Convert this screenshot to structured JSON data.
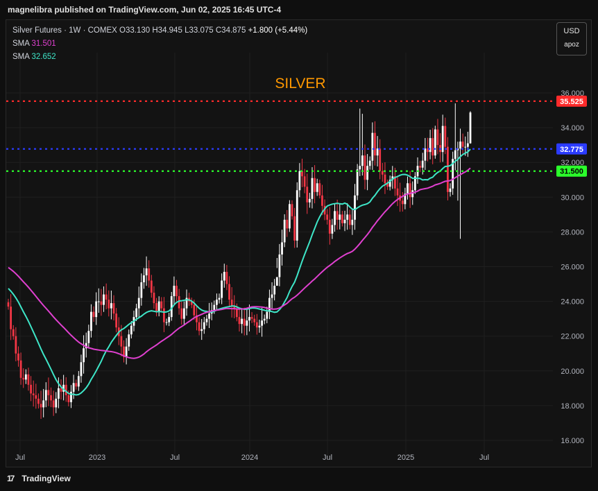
{
  "header": {
    "published_text": "magnelibra published on TradingView.com, Jun 02, 2025 16:45 UTC-4"
  },
  "legend": {
    "symbol": "Silver Futures · 1W · COMEX",
    "open_label": "O",
    "open": "33.130",
    "high_label": "H",
    "high": "34.945",
    "low_label": "L",
    "low": "33.075",
    "close_label": "C",
    "close": "34.875",
    "change": "+1.800 (+5.44%)",
    "sma1_label": "SMA",
    "sma1_value": "31.501",
    "sma2_label": "SMA",
    "sma2_value": "32.652"
  },
  "currency": {
    "code": "USD",
    "sub": "apoz"
  },
  "footer": {
    "brand": "TradingView"
  },
  "colors": {
    "up": "#ffffff",
    "down": "#f23645",
    "sma_long": "#e040d0",
    "sma_short": "#3ee6c8",
    "resistance": "#ff2b2b",
    "mid": "#2b3bff",
    "support": "#2bff2b",
    "title": "#ff9800"
  },
  "chart_data": {
    "type": "candlestick",
    "title": "SILVER",
    "ylim": [
      15.3,
      37.2
    ],
    "y_ticks": [
      "16.000",
      "18.000",
      "20.000",
      "22.000",
      "24.000",
      "26.000",
      "28.000",
      "30.000",
      "32.000",
      "34.000",
      "36.000"
    ],
    "x_ticks": [
      "Jul",
      "2023",
      "Jul",
      "2024",
      "Jul",
      "2025",
      "Jul"
    ],
    "horizontal_lines": [
      {
        "value": 35.525,
        "label": "35.525",
        "color": "#ff2b2b"
      },
      {
        "value": 32.775,
        "label": "32.775",
        "color": "#2b3bff"
      },
      {
        "value": 31.5,
        "label": "31.500",
        "color": "#2bff2b"
      }
    ],
    "series": [
      {
        "name": "SMA",
        "value": "31.501"
      },
      {
        "name": "SMA",
        "value": "32.652"
      }
    ],
    "closes": [
      23.7,
      22.4,
      22.0,
      21.0,
      20.6,
      19.6,
      19.5,
      19.8,
      19.2,
      18.7,
      18.6,
      18.4,
      18.1,
      17.9,
      18.3,
      18.9,
      18.6,
      18.3,
      17.9,
      18.4,
      19.0,
      18.8,
      19.2,
      18.6,
      18.2,
      18.8,
      19.3,
      19.1,
      19.7,
      20.5,
      21.3,
      21.6,
      22.3,
      23.4,
      23.1,
      24.0,
      24.0,
      23.8,
      24.4,
      24.1,
      23.6,
      23.9,
      23.3,
      22.5,
      22.0,
      21.4,
      20.8,
      21.4,
      22.1,
      22.6,
      23.1,
      23.6,
      24.2,
      25.1,
      25.5,
      25.9,
      25.2,
      24.5,
      23.9,
      23.4,
      24.0,
      23.6,
      22.8,
      22.8,
      23.1,
      24.3,
      24.9,
      24.3,
      23.6,
      23.0,
      23.6,
      24.2,
      24.0,
      23.8,
      23.2,
      22.8,
      22.3,
      22.4,
      22.8,
      23.0,
      23.3,
      23.5,
      23.8,
      24.1,
      24.2,
      25.2,
      25.7,
      25.0,
      24.1,
      23.7,
      23.6,
      23.1,
      22.7,
      23.0,
      22.6,
      22.9,
      23.1,
      23.0,
      22.8,
      22.5,
      22.6,
      22.9,
      23.0,
      23.4,
      24.2,
      24.4,
      24.9,
      25.4,
      26.7,
      27.4,
      28.7,
      28.2,
      29.6,
      28.9,
      27.5,
      30.4,
      31.5,
      31.2,
      30.6,
      29.7,
      29.9,
      31.1,
      30.3,
      30.8,
      30.1,
      29.5,
      29.0,
      28.7,
      27.9,
      28.4,
      29.2,
      28.7,
      29.0,
      28.5,
      28.7,
      29.0,
      28.4,
      28.7,
      30.1,
      31.6,
      31.8,
      32.4,
      31.0,
      31.8,
      32.1,
      33.7,
      32.4,
      32.8,
      31.5,
      31.3,
      30.8,
      30.6,
      31.0,
      31.2,
      30.5,
      30.1,
      29.8,
      29.6,
      30.2,
      30.8,
      30.0,
      30.4,
      31.2,
      31.8,
      31.7,
      32.1,
      32.8,
      32.6,
      33.4,
      32.4,
      33.9,
      33.0,
      32.6,
      34.1,
      32.9,
      30.3,
      30.5,
      32.2,
      32.7,
      32.8,
      33.2,
      32.9,
      32.9,
      33.1,
      34.875
    ]
  }
}
